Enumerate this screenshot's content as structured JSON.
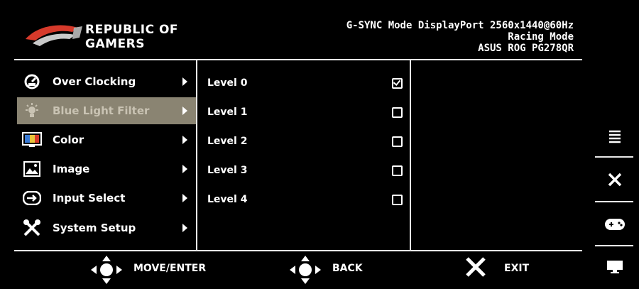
{
  "brand": {
    "line1": "REPUBLIC OF",
    "line2": "GAMERS"
  },
  "info": {
    "line1": "G-SYNC Mode DisplayPort 2560x1440@60Hz",
    "line2": "Racing Mode",
    "line3": "ASUS ROG PG278QR"
  },
  "menu": {
    "items": [
      {
        "label": "Over Clocking",
        "icon": "speedometer-icon"
      },
      {
        "label": "Blue Light Filter",
        "icon": "light-bulb-icon",
        "selected": true
      },
      {
        "label": "Color",
        "icon": "color-monitor-icon"
      },
      {
        "label": "Image",
        "icon": "image-icon"
      },
      {
        "label": "Input Select",
        "icon": "input-icon"
      },
      {
        "label": "System Setup",
        "icon": "tools-icon"
      }
    ]
  },
  "levels": [
    {
      "label": "Level 0",
      "checked": true
    },
    {
      "label": "Level 1",
      "checked": false
    },
    {
      "label": "Level 2",
      "checked": false
    },
    {
      "label": "Level 3",
      "checked": false
    },
    {
      "label": "Level 4",
      "checked": false
    }
  ],
  "side_buttons": [
    "menu-lines-icon",
    "close-icon",
    "gamepad-icon",
    "monitor-icon"
  ],
  "footer": {
    "move": "MOVE/ENTER",
    "back": "BACK",
    "exit": "EXIT"
  },
  "colors": {
    "selected_bg": "#8a8472",
    "line": "#e8e8e8",
    "logo_red": "#d63a2b"
  }
}
